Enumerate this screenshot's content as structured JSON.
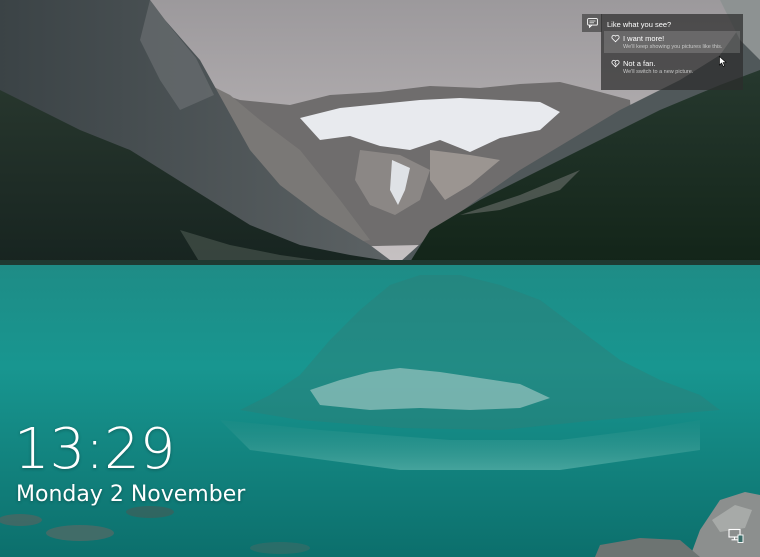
{
  "lockscreen": {
    "time": "13:29",
    "date": "Monday 2 November"
  },
  "spotlight": {
    "title": "Like what you see?",
    "options": [
      {
        "label": "I want more!",
        "sub": "We'll keep showing you pictures like this.",
        "icon": "heart-icon"
      },
      {
        "label": "Not a fan.",
        "sub": "We'll switch to a new picture.",
        "icon": "broken-heart-icon"
      }
    ]
  },
  "icons": {
    "spotlight": "spotlight-chat-icon",
    "network": "network-icon",
    "cursor": "mouse-cursor-icon"
  }
}
